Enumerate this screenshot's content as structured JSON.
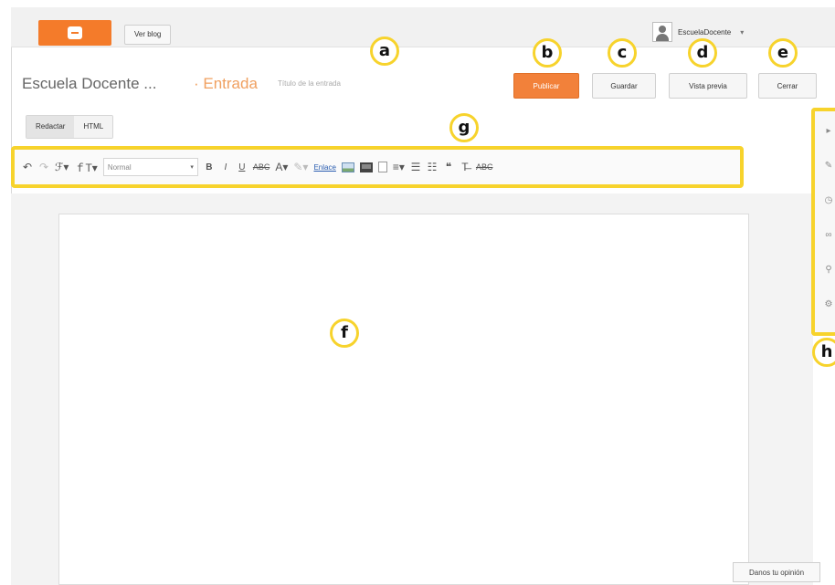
{
  "topbar": {
    "view_blog": "Ver blog",
    "user_name": "EscuelaDocente",
    "user_caret": "▾"
  },
  "post": {
    "blog_name": "Escuela Docente ...",
    "entry_label": "· Entrada",
    "title_placeholder": "Título de la entrada"
  },
  "actions": {
    "publish": "Publicar",
    "save": "Guardar",
    "preview": "Vista previa",
    "close": "Cerrar"
  },
  "modes": {
    "compose": "Redactar",
    "html": "HTML"
  },
  "toolbar": {
    "undo": "↶",
    "redo": "↷",
    "font_family": "ℱ▾",
    "font_size": "ｆT▾",
    "format_value": "Normal",
    "format_caret": "▾",
    "bold": "B",
    "italic": "I",
    "underline": "U",
    "strike": "ABC",
    "text_color": "A▾",
    "highlight": "✎▾",
    "link": "Enlace",
    "align": "≡▾",
    "numbered": "☰",
    "bulleted": "☷",
    "quote": "❝",
    "clear_format": "T̶",
    "spellcheck": "ABC"
  },
  "side_icons": [
    "▸",
    "✎",
    "◷",
    "∞",
    "⚲",
    "⚙"
  ],
  "feedback": "Danos tu opinión",
  "markers": [
    "a",
    "b",
    "c",
    "d",
    "e",
    "f",
    "g",
    "h"
  ],
  "colors": {
    "accent": "#f47b2a",
    "highlight_frame": "#f7d32c"
  }
}
